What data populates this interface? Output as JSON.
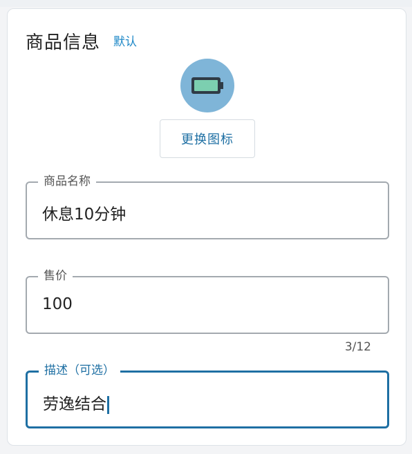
{
  "section": {
    "title": "商品信息",
    "badge": "默认"
  },
  "icon": {
    "name": "battery-icon",
    "circle_color": "#7fb5d8",
    "fill_color": "#7ccfb0"
  },
  "change_icon_button": {
    "label": "更换图标"
  },
  "fields": {
    "name": {
      "label": "商品名称",
      "value": "休息10分钟"
    },
    "price": {
      "label": "售价",
      "value": "100",
      "counter": "3/12"
    },
    "description": {
      "label": "描述（可选）",
      "value": "劳逸结合"
    }
  },
  "colors": {
    "accent": "#1e6fa3",
    "border": "#a3a9af"
  }
}
